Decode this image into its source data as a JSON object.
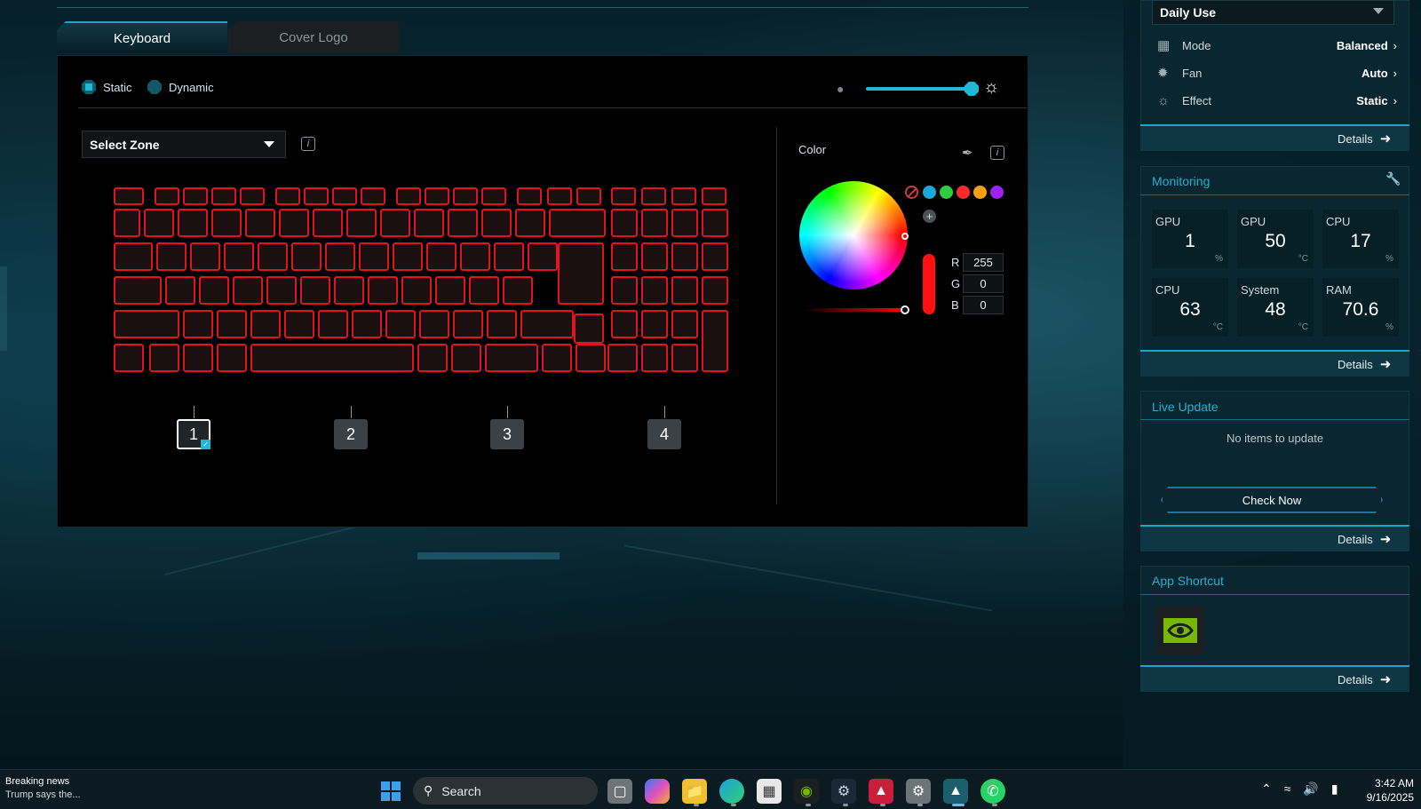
{
  "tabs": [
    {
      "label": "Keyboard",
      "active": true
    },
    {
      "label": "Cover Logo",
      "active": false
    }
  ],
  "lighting_mode": {
    "options": [
      {
        "label": "Static",
        "selected": true
      },
      {
        "label": "Dynamic",
        "selected": false
      }
    ]
  },
  "brightness_level_percent": 100,
  "zone_select": {
    "label": "Select Zone"
  },
  "zones": [
    {
      "label": "1",
      "selected": true
    },
    {
      "label": "2",
      "selected": false
    },
    {
      "label": "3",
      "selected": false
    },
    {
      "label": "4",
      "selected": false
    }
  ],
  "key_color": "#e0141a",
  "color_panel": {
    "label": "Color",
    "presets": [
      "none",
      "#1aa7d9",
      "#2ecc40",
      "#ff2a2a",
      "#ff9f10",
      "#a020f0"
    ],
    "rgb": {
      "r_label": "R",
      "r": "255",
      "g_label": "G",
      "g": "0",
      "b_label": "B",
      "b": "0"
    }
  },
  "sidebar": {
    "profile": {
      "selected": "Daily Use"
    },
    "properties": [
      {
        "icon": "grid-icon",
        "label": "Mode",
        "value": "Balanced"
      },
      {
        "icon": "fan-icon",
        "label": "Fan",
        "value": "Auto"
      },
      {
        "icon": "sun-icon",
        "label": "Effect",
        "value": "Static"
      }
    ],
    "details_label": "Details",
    "monitoring": {
      "title": "Monitoring",
      "metrics": [
        {
          "label": "GPU",
          "value": "1",
          "unit": "%"
        },
        {
          "label": "GPU",
          "value": "50",
          "unit": "°C"
        },
        {
          "label": "CPU",
          "value": "17",
          "unit": "%"
        },
        {
          "label": "CPU",
          "value": "63",
          "unit": "°C"
        },
        {
          "label": "System",
          "value": "48",
          "unit": "°C"
        },
        {
          "label": "RAM",
          "value": "70.6",
          "unit": "%"
        }
      ]
    },
    "live_update": {
      "title": "Live Update",
      "status": "No items to update",
      "button": "Check Now"
    },
    "app_shortcut": {
      "title": "App Shortcut"
    }
  },
  "taskbar": {
    "news_title": "Breaking news",
    "news_sub": "Trump says the...",
    "search_placeholder": "Search",
    "clock_time": "3:42 AM",
    "clock_date": "9/16/2025"
  }
}
